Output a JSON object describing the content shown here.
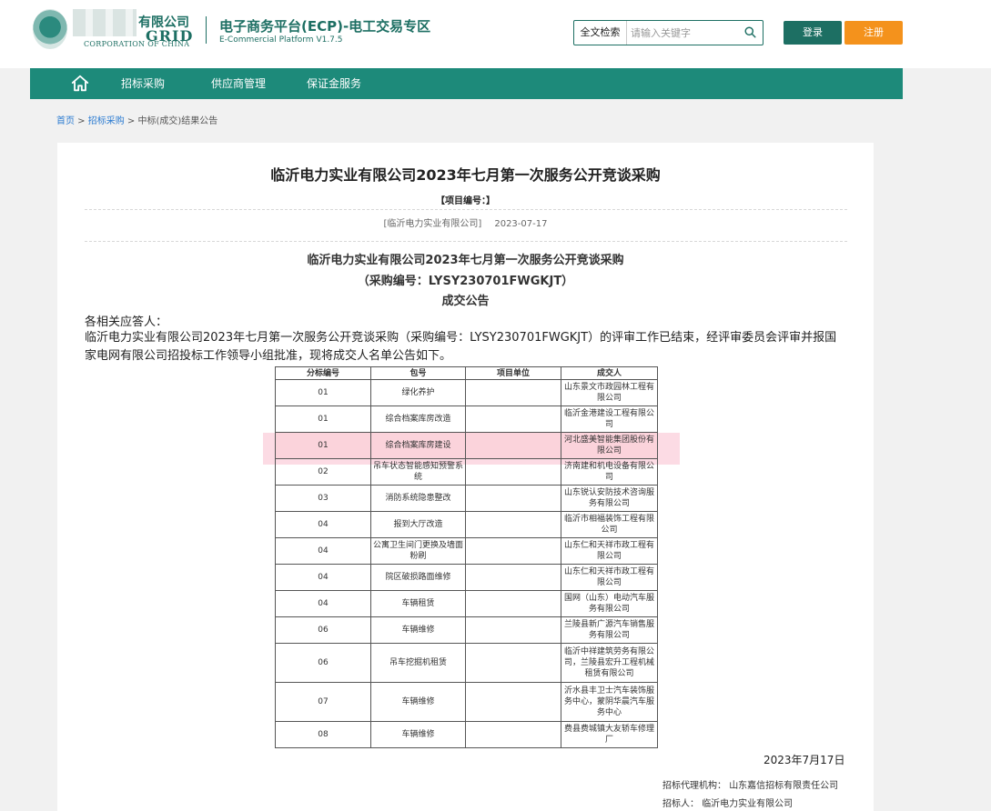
{
  "header": {
    "logo_cn": "有限公司",
    "logo_grid": "GRID",
    "logo_corp": "CORPORATION OF CHINA",
    "platform_title": "电子商务平台(ECP)-电工交易专区",
    "platform_sub": "E-Commercial Platform V1.7.5",
    "search_type": "全文检索",
    "search_placeholder": "请输入关键字",
    "login_label": "登录",
    "register_label": "注册"
  },
  "nav": {
    "items": [
      {
        "label": "招标采购"
      },
      {
        "label": "供应商管理"
      },
      {
        "label": "保证金服务"
      }
    ]
  },
  "breadcrumb": {
    "home": "首页",
    "sep1": " > ",
    "level1": "招标采购",
    "sep2": " > ",
    "current": "中标(成交)结果公告"
  },
  "article": {
    "title": "临沂电力实业有限公司2023年七月第一次服务公开竞谈采购",
    "project_no": "【项目编号：】",
    "publisher": "[临沂电力实业有限公司]",
    "date": "2023-07-17",
    "heading1": "临沂电力实业有限公司2023年七月第一次服务公开竞谈采购",
    "heading2": "（采购编号：LYSY230701FWGKJT）",
    "heading3": "成交公告",
    "greeting": "各相关应答人：",
    "body": "临沂电力实业有限公司2023年七月第一次服务公开竞谈采购（采购编号：LYSY230701FWGKJT）的评审工作已结束，经评审委员会评审并报国家电网有限公司招投标工作领导小组批准，现将成交人名单公告如下。",
    "table_headers": [
      "分标编号",
      "包号",
      "项目单位",
      "成交人"
    ],
    "table_rows": [
      {
        "lot": "01",
        "pkg": "绿化养护",
        "unit": "",
        "winner": "山东景文市政园林工程有限公司"
      },
      {
        "lot": "01",
        "pkg": "综合档案库房改造",
        "unit": "",
        "winner": "临沂金港建设工程有限公司"
      },
      {
        "lot": "01",
        "pkg": "综合档案库房建设",
        "unit": "",
        "winner": "河北盛美智能集团股份有限公司"
      },
      {
        "lot": "02",
        "pkg": "吊车状态智能感知预警系统",
        "unit": "",
        "winner": "济南建和机电设备有限公司"
      },
      {
        "lot": "03",
        "pkg": "消防系统隐患整改",
        "unit": "",
        "winner": "山东锐认安防技术咨询服务有限公司"
      },
      {
        "lot": "04",
        "pkg": "报到大厅改造",
        "unit": "",
        "winner": "临沂市相福装饰工程有限公司"
      },
      {
        "lot": "04",
        "pkg": "公寓卫生间门更换及墙面粉刷",
        "unit": "",
        "winner": "山东仁和天祥市政工程有限公司"
      },
      {
        "lot": "04",
        "pkg": "院区破损路面维修",
        "unit": "",
        "winner": "山东仁和天祥市政工程有限公司"
      },
      {
        "lot": "04",
        "pkg": "车辆租赁",
        "unit": "",
        "winner": "国网（山东）电动汽车服务有限公司"
      },
      {
        "lot": "06",
        "pkg": "车辆维修",
        "unit": "",
        "winner": "兰陵县新广源汽车销售服务有限公司"
      },
      {
        "lot": "06",
        "pkg": "吊车挖掘机租赁",
        "unit": "",
        "winner": "临沂中祥建筑劳务有限公司，兰陵县宏升工程机械租赁有限公司"
      },
      {
        "lot": "07",
        "pkg": "车辆维修",
        "unit": "",
        "winner": "沂水县丰卫士汽车装饰服务中心，蒙阴华晨汽车服务中心"
      },
      {
        "lot": "08",
        "pkg": "车辆维修",
        "unit": "",
        "winner": "费县费城镇大友轿车修理厂"
      }
    ],
    "sign_date": "2023年7月17日",
    "agency_label": "招标代理机构：",
    "agency": "山东嘉信招标有限责任公司",
    "buyer_label": "招标人：",
    "buyer": "临沂电力实业有限公司"
  },
  "colors": {
    "brand": "#1d6f63",
    "nav": "#1d8a7a",
    "register": "#f4921c",
    "highlight": "#fbd3db"
  }
}
